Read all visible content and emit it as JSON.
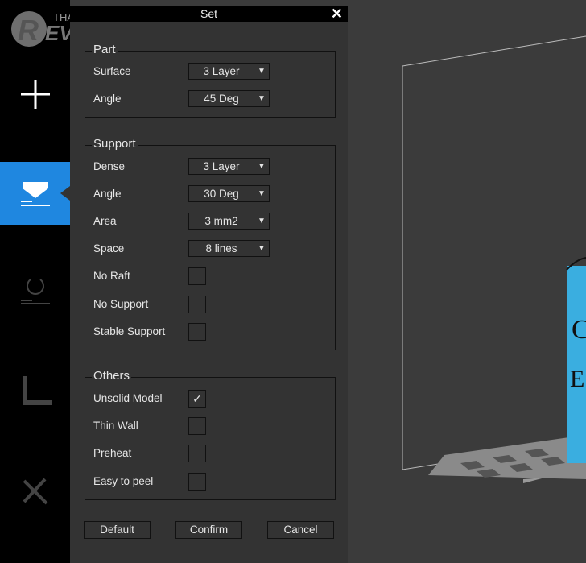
{
  "watermark": {
    "text": "THAIWARE REVIEW"
  },
  "sidebar": {
    "items": [
      {
        "name": "add",
        "icon": "plus-icon"
      },
      {
        "name": "support",
        "icon": "support-icon",
        "active": true
      },
      {
        "name": "rotate",
        "icon": "rotate-icon"
      },
      {
        "name": "measure",
        "icon": "ruler-icon"
      },
      {
        "name": "tools",
        "icon": "tools-icon"
      }
    ]
  },
  "dialog": {
    "title": "Set",
    "close": "✕",
    "part": {
      "legend": "Part",
      "rows": [
        {
          "label": "Surface",
          "value": "3 Layer"
        },
        {
          "label": "Angle",
          "value": "45 Deg"
        }
      ]
    },
    "support": {
      "legend": "Support",
      "rows": [
        {
          "label": "Dense",
          "value": "3 Layer"
        },
        {
          "label": "Angle",
          "value": "30 Deg"
        },
        {
          "label": "Area",
          "value": "3 mm2"
        },
        {
          "label": "Space",
          "value": "8 lines"
        }
      ],
      "checks": [
        {
          "label": "No Raft",
          "checked": false
        },
        {
          "label": "No Support",
          "checked": false
        },
        {
          "label": "Stable Support",
          "checked": false
        }
      ]
    },
    "others": {
      "legend": "Others",
      "checks": [
        {
          "label": "Unsolid Model",
          "checked": true,
          "mark": "✓"
        },
        {
          "label": "Thin Wall",
          "checked": false
        },
        {
          "label": "Preheat",
          "checked": false
        },
        {
          "label": "Easy to peel",
          "checked": false
        }
      ]
    },
    "buttons": {
      "default": "Default",
      "confirm": "Confirm",
      "cancel": "Cancel"
    },
    "arrow": "▼"
  },
  "colors": {
    "accent": "#1f87e0",
    "model": "#3aaee0"
  }
}
